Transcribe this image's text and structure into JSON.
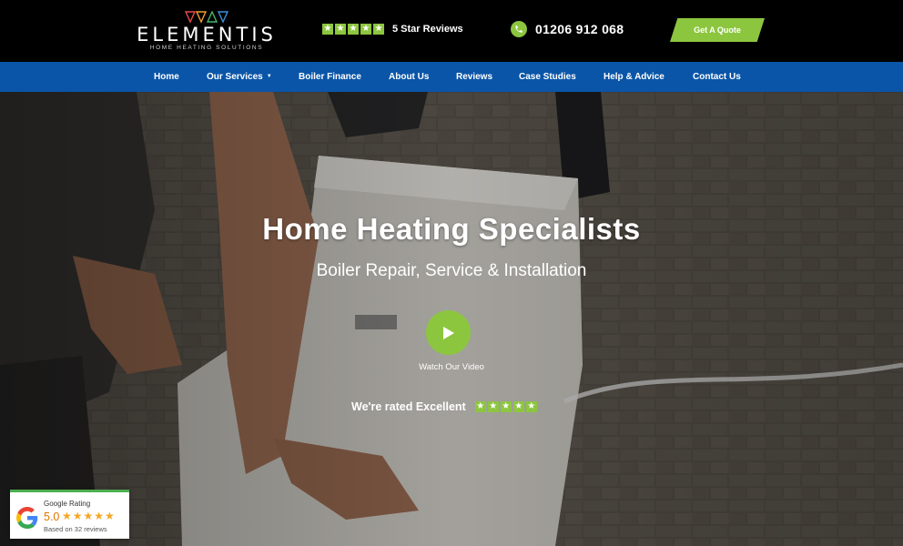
{
  "brand": {
    "name": "ELEMENTIS",
    "tagline": "HOME HEATING SOLUTIONS"
  },
  "header": {
    "reviews_label": "5 Star Reviews",
    "phone": "01206 912 068",
    "quote_button": "Get A Quote",
    "star_glyph": "★"
  },
  "nav": {
    "items": [
      {
        "label": "Home",
        "has_dropdown": false
      },
      {
        "label": "Our Services",
        "has_dropdown": true
      },
      {
        "label": "Boiler Finance",
        "has_dropdown": false
      },
      {
        "label": "About Us",
        "has_dropdown": false
      },
      {
        "label": "Reviews",
        "has_dropdown": false
      },
      {
        "label": "Case Studies",
        "has_dropdown": false
      },
      {
        "label": "Help & Advice",
        "has_dropdown": false
      },
      {
        "label": "Contact Us",
        "has_dropdown": false
      }
    ],
    "caret": "▼"
  },
  "hero": {
    "title": "Home Heating Specialists",
    "subtitle": "Boiler Repair, Service & Installation",
    "watch_label": "Watch Our Video",
    "rated_label": "We're rated Excellent"
  },
  "google_badge": {
    "title": "Google Rating",
    "score": "5.0",
    "stars": "★★★★★",
    "count": "Based on 32 reviews"
  },
  "colors": {
    "accent_green": "#8cc63f",
    "nav_blue": "#0a55a8",
    "topbar": "#000000",
    "rating_orange": "#e37400"
  },
  "icons": [
    "logo-triangles-icon",
    "phone-icon",
    "play-icon",
    "google-g-icon",
    "star-icon",
    "caret-down-icon"
  ]
}
